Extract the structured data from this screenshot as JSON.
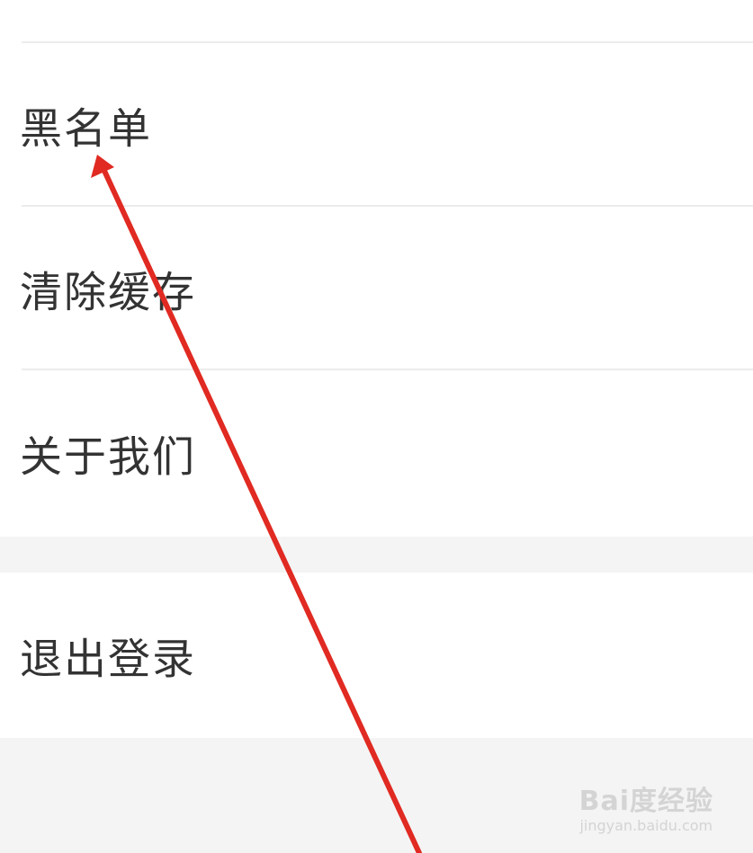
{
  "settings": {
    "items": [
      {
        "label": "黑名单"
      },
      {
        "label": "清除缓存"
      },
      {
        "label": "关于我们"
      }
    ],
    "logout_label": "退出登录"
  },
  "watermark": {
    "logo_text": "Bai度经验",
    "url_text": "jingyan.baidu.com"
  },
  "annotation": {
    "color": "#e02a22"
  }
}
